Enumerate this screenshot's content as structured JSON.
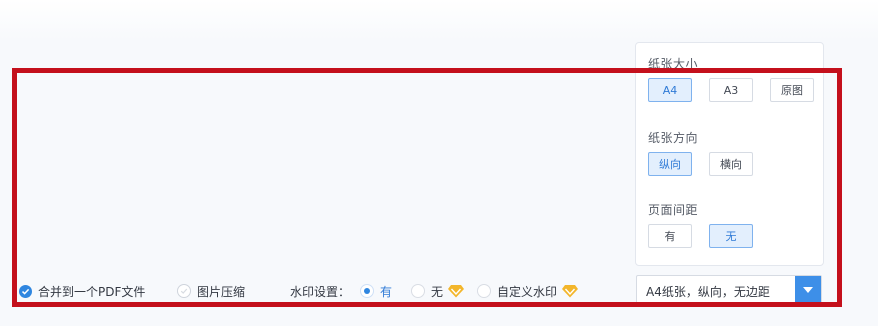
{
  "settings": {
    "paper_size": {
      "label": "纸张大小",
      "options": [
        "A4",
        "A3",
        "原图"
      ],
      "selected": "A4"
    },
    "orientation": {
      "label": "纸张方向",
      "options": [
        "纵向",
        "横向"
      ],
      "selected": "纵向"
    },
    "margin": {
      "label": "页面间距",
      "options": [
        "有",
        "无"
      ],
      "selected": "无"
    }
  },
  "options_bar": {
    "merge_pdf": {
      "label": "合并到一个PDF文件",
      "checked": true
    },
    "compress_images": {
      "label": "图片压缩",
      "checked": false
    },
    "watermark_label": "水印设置：",
    "watermark_on": {
      "label": "有",
      "selected": true
    },
    "watermark_off": {
      "label": "无",
      "selected": false
    },
    "custom_watermark": {
      "label": "自定义水印",
      "selected": false
    }
  },
  "summary": {
    "text": "A4纸张，纵向，无边距"
  },
  "colors": {
    "accent": "#2f86e0",
    "highlight": "#c4101c",
    "vip_badge": "#f3b62b"
  }
}
